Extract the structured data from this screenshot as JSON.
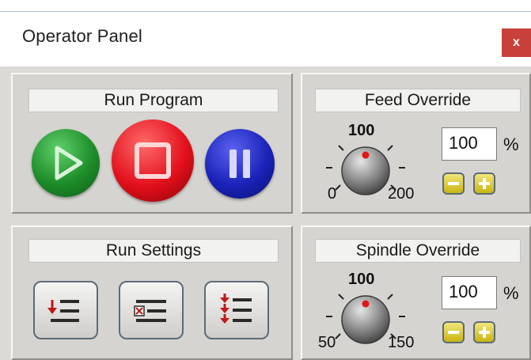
{
  "window": {
    "title": "Operator Panel",
    "close_label": "x"
  },
  "run_program": {
    "caption": "Run Program",
    "buttons": [
      {
        "name": "play-button",
        "icon": "play-icon",
        "color": "#1d8d2a"
      },
      {
        "name": "stop-button",
        "icon": "stop-icon",
        "color": "#e2101c"
      },
      {
        "name": "pause-button",
        "icon": "pause-icon",
        "color": "#1b22b8"
      }
    ]
  },
  "run_settings": {
    "caption": "Run Settings",
    "buttons": [
      {
        "name": "run-from-line-button",
        "icon": "run-from-line-icon"
      },
      {
        "name": "clear-settings-button",
        "icon": "clear-list-icon"
      },
      {
        "name": "step-mode-button",
        "icon": "step-list-icon"
      }
    ]
  },
  "feed_override": {
    "caption": "Feed Override",
    "knob_top_label": "100",
    "knob_min_label": "0",
    "knob_max_label": "200",
    "value": "100",
    "unit": "%",
    "minus_icon": "minus-icon",
    "plus_icon": "plus-icon"
  },
  "spindle_override": {
    "caption": "Spindle Override",
    "knob_top_label": "100",
    "knob_min_label": "50",
    "knob_max_label": "150",
    "value": "100",
    "unit": "%",
    "minus_icon": "minus-icon",
    "plus_icon": "plus-icon"
  },
  "colors": {
    "accent_close": "#c8403a",
    "step_button": "#e0cf2a"
  }
}
